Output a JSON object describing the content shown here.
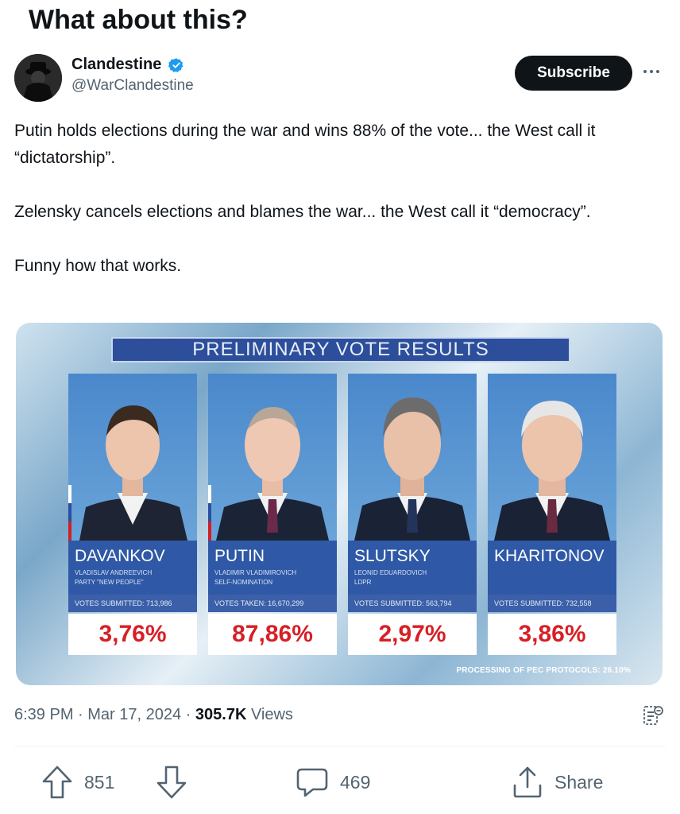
{
  "caption": "What about this?",
  "post": {
    "author_name": "Clandestine",
    "author_handle": "@WarClandestine",
    "subscribe_label": "Subscribe",
    "paragraphs": [
      "Putin holds elections during the war and wins 88% of the vote... the West call it “dictatorship”.",
      "Zelensky cancels elections and blames the war... the West call it “democracy”.",
      "Funny how that works."
    ],
    "timestamp": "6:39 PM · Mar 17, 2024 · ",
    "views_count": "305.7K",
    "views_label": " Views"
  },
  "media": {
    "banner": "PRELIMINARY VOTE RESULTS",
    "candidates": [
      {
        "name": "DAVANKOV",
        "line1": "VLADISLAV ANDREEVICH",
        "line2": "PARTY \"NEW PEOPLE\"",
        "votes": "VOTES SUBMITTED: 713,986",
        "pct": "3,76%"
      },
      {
        "name": "PUTIN",
        "line1": "VLADIMIR VLADIMIROVICH",
        "line2": "SELF-NOMINATION",
        "votes": "VOTES TAKEN: 16,670,299",
        "pct": "87,86%"
      },
      {
        "name": "SLUTSKY",
        "line1": "LEONID EDUARDOVICH",
        "line2": "LDPR",
        "votes": "VOTES SUBMITTED: 563,794",
        "pct": "2,97%"
      },
      {
        "name": "KHARITONOV",
        "line1": "",
        "line2": "",
        "votes": "VOTES SUBMITTED: 732,558",
        "pct": "3,86%"
      }
    ],
    "footer": "PROCESSING OF PEC PROTOCOLS: 26.10%"
  },
  "actions": {
    "upvote_count": "851",
    "reply_count": "469",
    "share_label": "Share"
  },
  "colors": {
    "accent_dark": "#0f1419",
    "muted": "#536471",
    "verified_blue": "#1d9bf0",
    "banner_blue": "#2c4e9b",
    "pct_red": "#d71f25"
  },
  "icons": [
    "verified-badge-icon",
    "more-icon",
    "analytics-icon",
    "upvote-icon",
    "downvote-icon",
    "reply-icon",
    "share-icon"
  ]
}
